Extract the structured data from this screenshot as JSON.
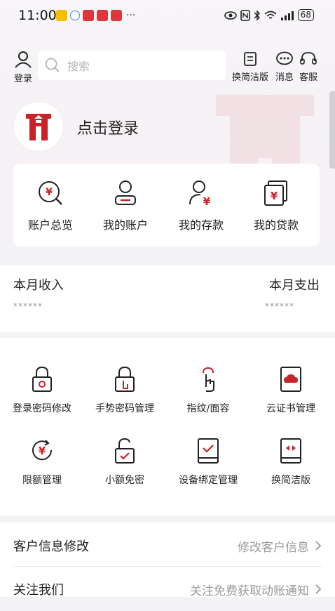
{
  "status_bar": {
    "time": "11:00",
    "dots": "···",
    "battery": "68"
  },
  "header": {
    "login_label": "登录",
    "search_placeholder": "搜索",
    "simple_label": "换简洁版",
    "message_label": "消息",
    "service_label": "客服"
  },
  "profile": {
    "login_prompt": "点击登录"
  },
  "quick_actions": [
    {
      "label": "账户总览",
      "icon": "yuan-search-icon"
    },
    {
      "label": "我的账户",
      "icon": "user-card-icon"
    },
    {
      "label": "我的存款",
      "icon": "user-yuan-icon"
    },
    {
      "label": "我的贷款",
      "icon": "yuan-cards-icon"
    }
  ],
  "income": {
    "income_label": "本月收入",
    "income_value": "******",
    "expense_label": "本月支出",
    "expense_value": "******"
  },
  "security": [
    {
      "label": "登录密码修改",
      "icon": "lock-gear-icon"
    },
    {
      "label": "手势密码管理",
      "icon": "lock-hand-icon"
    },
    {
      "label": "指纹/面容",
      "icon": "touch-icon"
    },
    {
      "label": "云证书管理",
      "icon": "cloud-cert-icon"
    },
    {
      "label": "限额管理",
      "icon": "yuan-limit-icon"
    },
    {
      "label": "小额免密",
      "icon": "unlock-check-icon"
    },
    {
      "label": "设备绑定管理",
      "icon": "device-check-icon"
    },
    {
      "label": "换简洁版",
      "icon": "device-switch-icon"
    }
  ],
  "rows": [
    {
      "title": "客户信息修改",
      "value": "修改客户信息"
    },
    {
      "title": "关注我们",
      "value": "关注免费获取动账通知"
    }
  ],
  "colors": {
    "accent": "#c8222a",
    "text": "#222222",
    "muted": "#999999"
  }
}
